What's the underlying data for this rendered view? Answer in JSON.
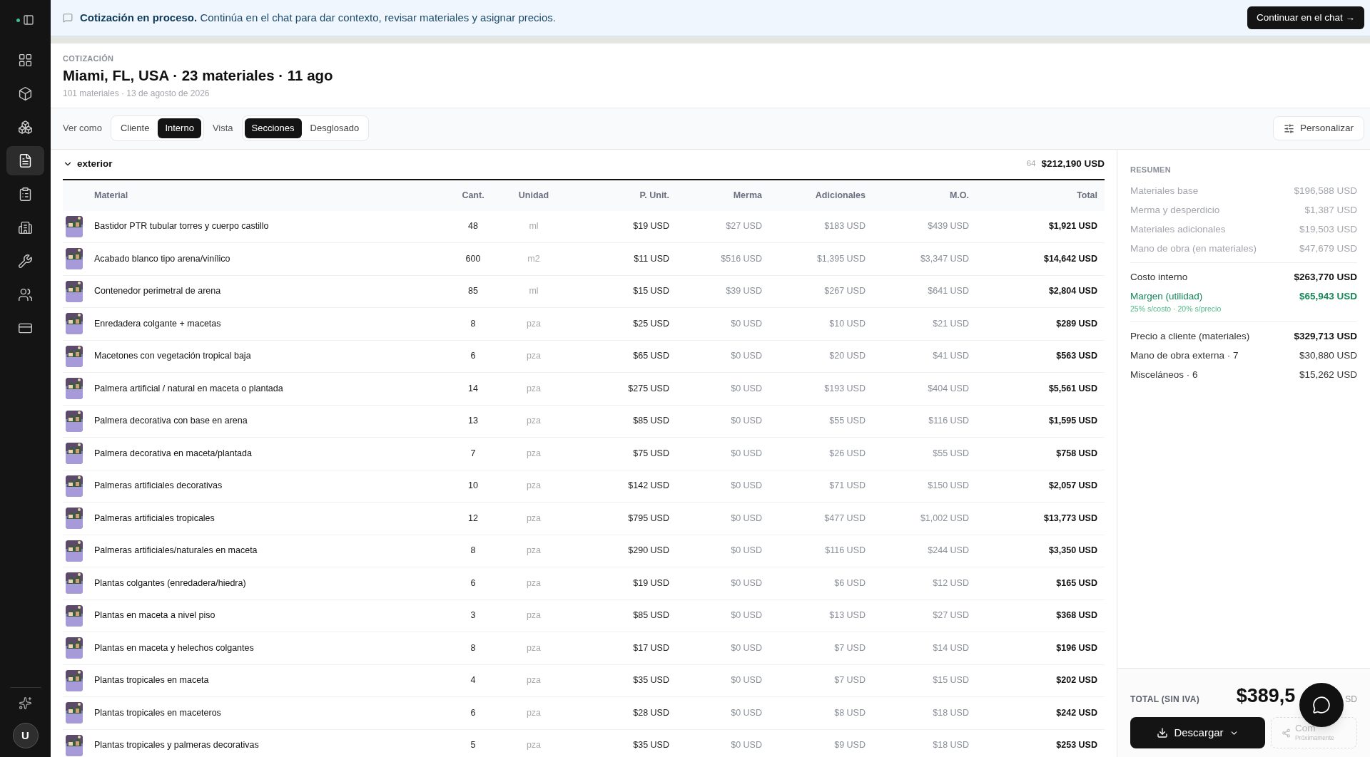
{
  "sidebar": {
    "items": [
      {
        "selected": false
      },
      {
        "selected": false
      },
      {
        "selected": false
      },
      {
        "selected": true
      },
      {
        "selected": false
      },
      {
        "selected": false
      },
      {
        "selected": false
      },
      {
        "selected": false
      },
      {
        "selected": false
      }
    ],
    "avatar": "U"
  },
  "banner": {
    "title": "Cotización en proceso.",
    "text": "Continúa en el chat para dar contexto, revisar materiales y asignar precios.",
    "button": "Continuar en el chat →"
  },
  "header": {
    "eyebrow": "COTIZACIÓN",
    "title": "Miami, FL, USA · 23 materiales · 11 ago",
    "subtitle": "101 materiales · 13 de agosto de 2026"
  },
  "toolbar": {
    "groups": [
      {
        "label": "Ver como",
        "options": [
          {
            "label": "Cliente",
            "selected": false
          },
          {
            "label": "Interno",
            "selected": true
          }
        ]
      },
      {
        "label": "Vista",
        "options": [
          {
            "label": "Secciones",
            "selected": true
          },
          {
            "label": "Desglosado",
            "selected": false
          }
        ]
      }
    ],
    "customize": "Personalizar"
  },
  "section": {
    "name": "exterior",
    "expanded": true,
    "count": "64",
    "total": "$212,190 USD"
  },
  "table": {
    "columns": [
      "Material",
      "Cant.",
      "Unidad",
      "P. Unit.",
      "Merma",
      "Adicionales",
      "M.O.",
      "Total"
    ],
    "rows": [
      [
        "Bastidor PTR tubular torres y cuerpo castillo",
        "48",
        "ml",
        "$19 USD",
        "$27 USD",
        "$183 USD",
        "$439 USD",
        "$1,921 USD"
      ],
      [
        "Acabado blanco tipo arena/vinílico",
        "600",
        "m2",
        "$11 USD",
        "$516 USD",
        "$1,395 USD",
        "$3,347 USD",
        "$14,642 USD"
      ],
      [
        "Contenedor perimetral de arena",
        "85",
        "ml",
        "$15 USD",
        "$39 USD",
        "$267 USD",
        "$641 USD",
        "$2,804 USD"
      ],
      [
        "Enredadera colgante + macetas",
        "8",
        "pza",
        "$25 USD",
        "$0 USD",
        "$10 USD",
        "$21 USD",
        "$289 USD"
      ],
      [
        "Macetones con vegetación tropical baja",
        "6",
        "pza",
        "$65 USD",
        "$0 USD",
        "$20 USD",
        "$41 USD",
        "$563 USD"
      ],
      [
        "Palmera artificial / natural en maceta o plantada",
        "14",
        "pza",
        "$275 USD",
        "$0 USD",
        "$193 USD",
        "$404 USD",
        "$5,561 USD"
      ],
      [
        "Palmera decorativa con base en arena",
        "13",
        "pza",
        "$85 USD",
        "$0 USD",
        "$55 USD",
        "$116 USD",
        "$1,595 USD"
      ],
      [
        "Palmera decorativa en maceta/plantada",
        "7",
        "pza",
        "$75 USD",
        "$0 USD",
        "$26 USD",
        "$55 USD",
        "$758 USD"
      ],
      [
        "Palmeras artificiales decorativas",
        "10",
        "pza",
        "$142 USD",
        "$0 USD",
        "$71 USD",
        "$150 USD",
        "$2,057 USD"
      ],
      [
        "Palmeras artificiales tropicales",
        "12",
        "pza",
        "$795 USD",
        "$0 USD",
        "$477 USD",
        "$1,002 USD",
        "$13,773 USD"
      ],
      [
        "Palmeras artificiales/naturales en maceta",
        "8",
        "pza",
        "$290 USD",
        "$0 USD",
        "$116 USD",
        "$244 USD",
        "$3,350 USD"
      ],
      [
        "Plantas colgantes (enredadera/hiedra)",
        "6",
        "pza",
        "$19 USD",
        "$0 USD",
        "$6 USD",
        "$12 USD",
        "$165 USD"
      ],
      [
        "Plantas en maceta a nivel piso",
        "3",
        "pza",
        "$85 USD",
        "$0 USD",
        "$13 USD",
        "$27 USD",
        "$368 USD"
      ],
      [
        "Plantas en maceta y helechos colgantes",
        "8",
        "pza",
        "$17 USD",
        "$0 USD",
        "$7 USD",
        "$14 USD",
        "$196 USD"
      ],
      [
        "Plantas tropicales en maceta",
        "4",
        "pza",
        "$35 USD",
        "$0 USD",
        "$7 USD",
        "$15 USD",
        "$202 USD"
      ],
      [
        "Plantas tropicales en maceteros",
        "6",
        "pza",
        "$28 USD",
        "$0 USD",
        "$8 USD",
        "$18 USD",
        "$242 USD"
      ],
      [
        "Plantas tropicales y palmeras decorativas",
        "5",
        "pza",
        "$35 USD",
        "$0 USD",
        "$9 USD",
        "$18 USD",
        "$253 USD"
      ]
    ]
  },
  "summary": {
    "title": "RESUMEN",
    "groups": [
      [
        {
          "label": "Materiales base",
          "value": "$196,588 USD",
          "kind": "muted"
        },
        {
          "label": "Merma y desperdicio",
          "value": "$1,387 USD",
          "kind": "muted"
        },
        {
          "label": "Materiales adicionales",
          "value": "$19,503 USD",
          "kind": "muted"
        },
        {
          "label": "Mano de obra (en materiales)",
          "value": "$47,679 USD",
          "kind": "muted"
        }
      ],
      [
        {
          "label": "Costo interno",
          "value": "$263,770 USD",
          "kind": "strong"
        },
        {
          "label": "Margen (utilidad)",
          "value": "$65,943 USD",
          "kind": "accent",
          "note": "25% s/costo · 20% s/precio"
        }
      ],
      [
        {
          "label": "Precio a cliente (materiales)",
          "value": "$329,713 USD",
          "kind": "strong"
        },
        {
          "label": "Mano de obra externa · 7",
          "value": "$30,880 USD",
          "kind": "normal"
        },
        {
          "label": "Misceláneos · 6",
          "value": "$15,262 USD",
          "kind": "normal"
        }
      ]
    ],
    "total_label": "TOTAL (SIN IVA)",
    "total_value": "$389,5",
    "total_currency": "SD",
    "download": "Descargar",
    "share": "Com",
    "share_note": "Próximamente",
    "share_disabled": true
  }
}
